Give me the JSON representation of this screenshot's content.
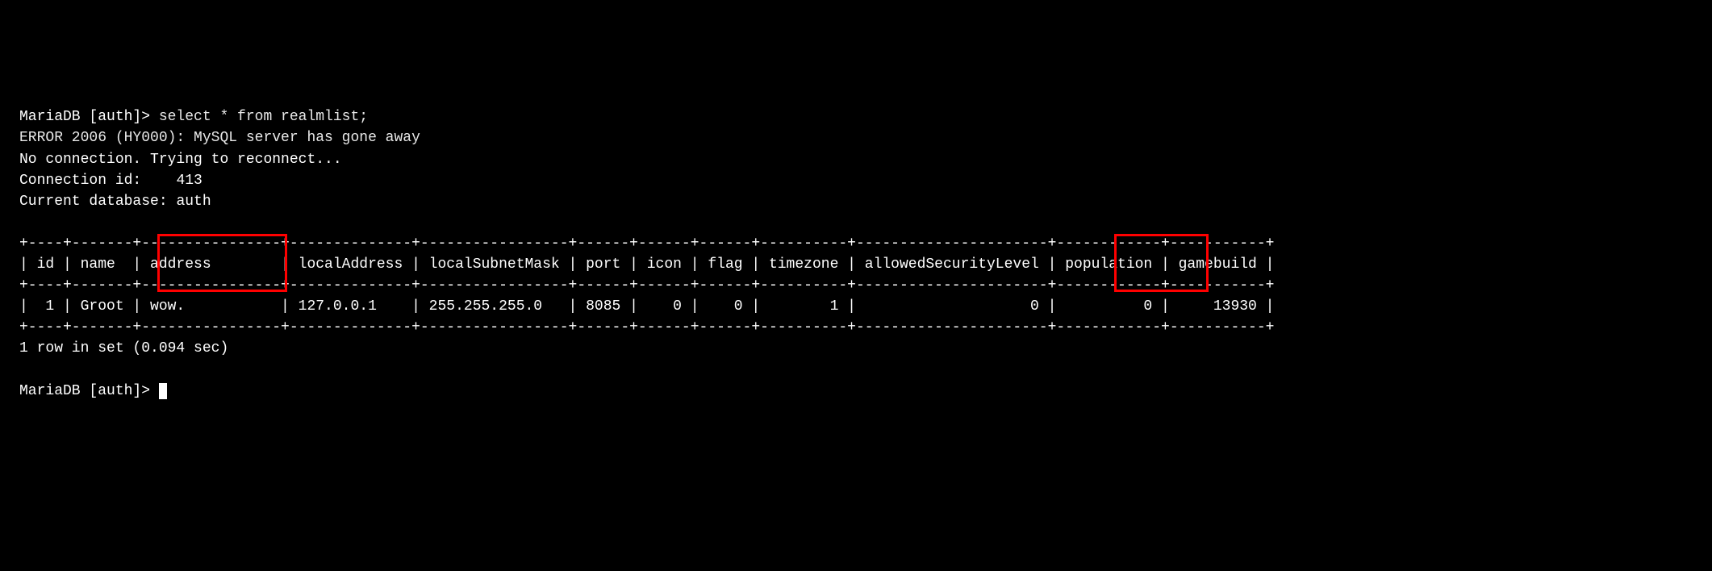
{
  "prompt1": "MariaDB [auth]> ",
  "query": "select * from realmlist;",
  "error_line": "ERROR 2006 (HY000): MySQL server has gone away",
  "reconnect_line": "No connection. Trying to reconnect...",
  "connection_id_label": "Connection id:    ",
  "connection_id_value": "413",
  "current_db_label": "Current database: ",
  "current_db_value": "auth",
  "table": {
    "border": "+----+-------+----------------+--------------+-----------------+------+------+------+----------+----------------------+------------+-----------+",
    "header": "| id | name  | address        | localAddress | localSubnetMask | port | icon | flag | timezone | allowedSecurityLevel | population | gamebuild |",
    "row": "|  1 | Groot | wow.           | 127.0.0.1    | 255.255.255.0   | 8085 |    0 |    0 |        1 |                    0 |          0 |     13930 |"
  },
  "result_summary": "1 row in set (0.094 sec)",
  "prompt2": "MariaDB [auth]> ",
  "chart_data": {
    "type": "table",
    "columns": [
      "id",
      "name",
      "address",
      "localAddress",
      "localSubnetMask",
      "port",
      "icon",
      "flag",
      "timezone",
      "allowedSecurityLevel",
      "population",
      "gamebuild"
    ],
    "rows": [
      {
        "id": 1,
        "name": "Groot",
        "address": "wow.",
        "localAddress": "127.0.0.1",
        "localSubnetMask": "255.255.255.0",
        "port": 8085,
        "icon": 0,
        "flag": 0,
        "timezone": 1,
        "allowedSecurityLevel": 0,
        "population": 0,
        "gamebuild": 13930
      }
    ],
    "highlighted_columns": [
      "address",
      "gamebuild"
    ]
  }
}
